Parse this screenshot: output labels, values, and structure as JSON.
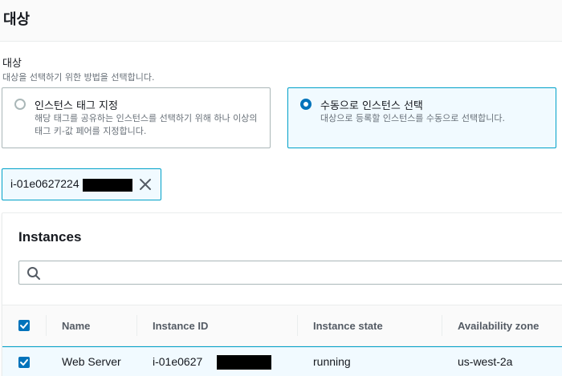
{
  "section": {
    "title": "대상"
  },
  "target_field": {
    "label": "대상",
    "description": "대상을 선택하기 위한 방법을 선택합니다."
  },
  "options": [
    {
      "label": "인스턴스 태그 지정",
      "description": "해당 태그를 공유하는 인스턴스를 선택하기 위해 하나 이상의 태그 키-값 페어를 지정합니다.",
      "selected": false
    },
    {
      "label": "수동으로 인스턴스 선택",
      "description": "대상으로 등록할 인스턴스를 수동으로 선택합니다.",
      "selected": true
    }
  ],
  "token": {
    "text": "i-01e0627224",
    "dismiss_icon": "close-icon"
  },
  "instances": {
    "title": "Instances",
    "search_placeholder": "",
    "columns": [
      "Name",
      "Instance ID",
      "Instance state",
      "Availability zone"
    ],
    "rows": [
      {
        "checked": true,
        "name": "Web Server",
        "instance_id": "i-01e0627",
        "state": "running",
        "zone": "us-west-2a"
      }
    ],
    "header_checked": true
  },
  "colors": {
    "accent": "#0073bb",
    "selected_border": "#00a1c9",
    "selected_bg": "#f1faff"
  }
}
